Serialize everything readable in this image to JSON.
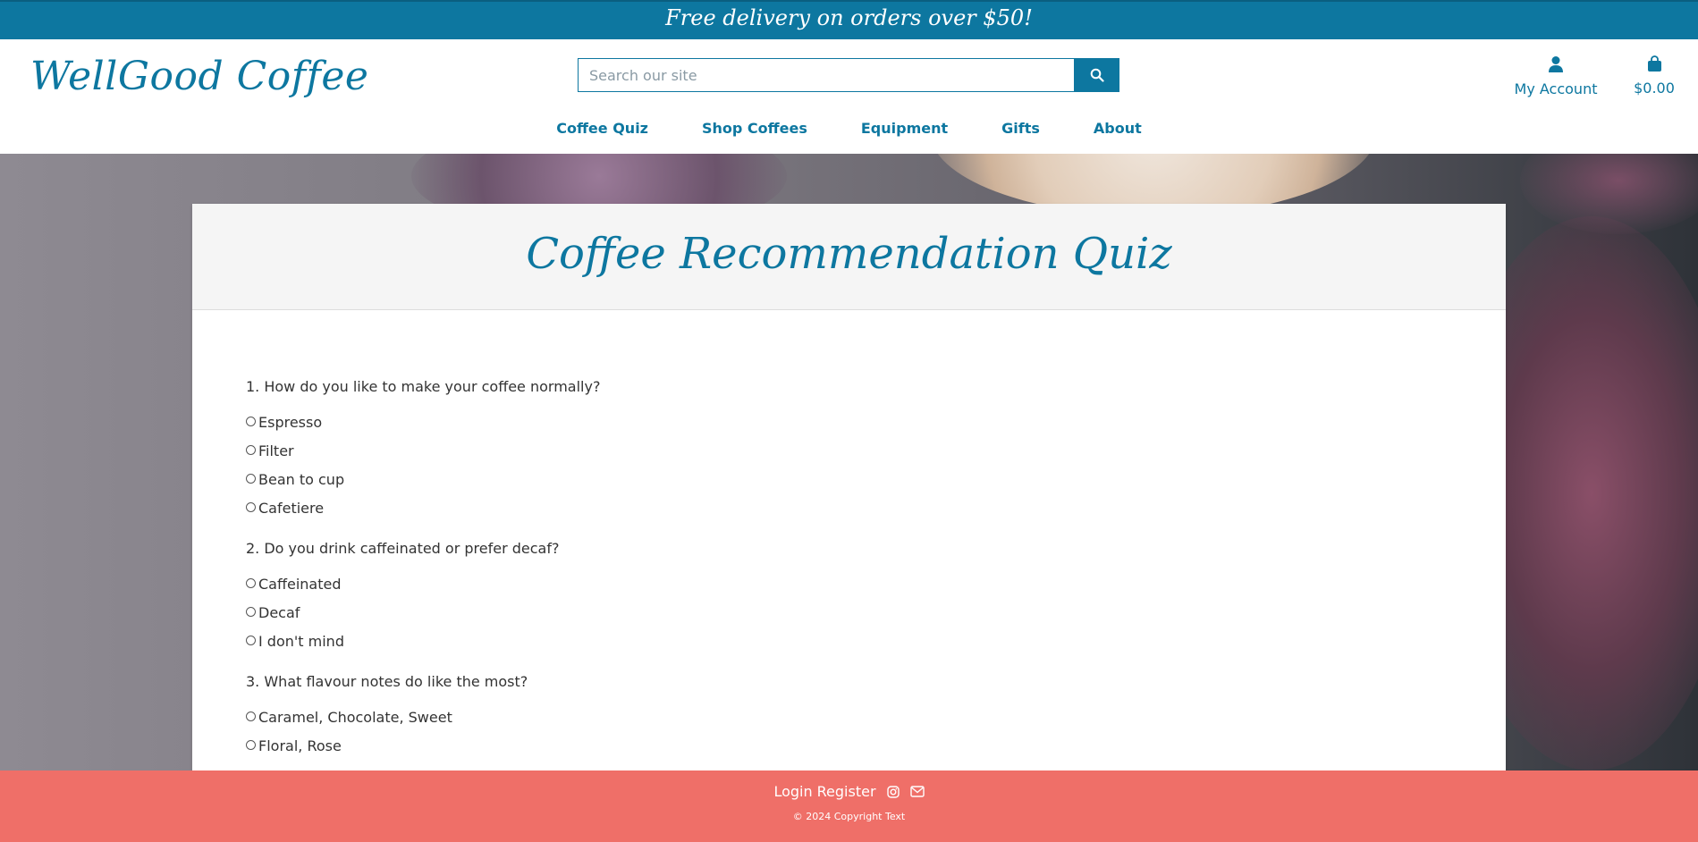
{
  "banner": {
    "text": "Free delivery on orders over $50!"
  },
  "header": {
    "brand": "WellGood Coffee",
    "search": {
      "placeholder": "Search our site",
      "value": ""
    },
    "account_label": "My Account",
    "cart_total": "$0.00"
  },
  "nav": {
    "items": [
      "Coffee Quiz",
      "Shop Coffees",
      "Equipment",
      "Gifts",
      "About"
    ]
  },
  "quiz": {
    "title": "Coffee Recommendation Quiz",
    "questions": [
      {
        "text": "1. How do you like to make your coffee normally?",
        "options": [
          "Espresso",
          "Filter",
          "Bean to cup",
          "Cafetiere"
        ]
      },
      {
        "text": "2. Do you drink caffeinated or prefer decaf?",
        "options": [
          "Caffeinated",
          "Decaf",
          "I don't mind"
        ]
      },
      {
        "text": "3. What flavour notes do like the most?",
        "options": [
          "Caramel, Chocolate, Sweet",
          "Floral, Rose"
        ]
      }
    ]
  },
  "footer": {
    "login": "Login",
    "register": "Register",
    "copyright": "© 2024 Copyright Text"
  },
  "icons": {
    "search": "search-icon",
    "account": "user-icon",
    "cart": "shopping-bag-icon",
    "instagram": "instagram-icon",
    "email": "envelope-icon"
  },
  "colors": {
    "primary": "#0d77a0",
    "footer": "#ef6f68",
    "card_header": "#f5f5f5"
  }
}
